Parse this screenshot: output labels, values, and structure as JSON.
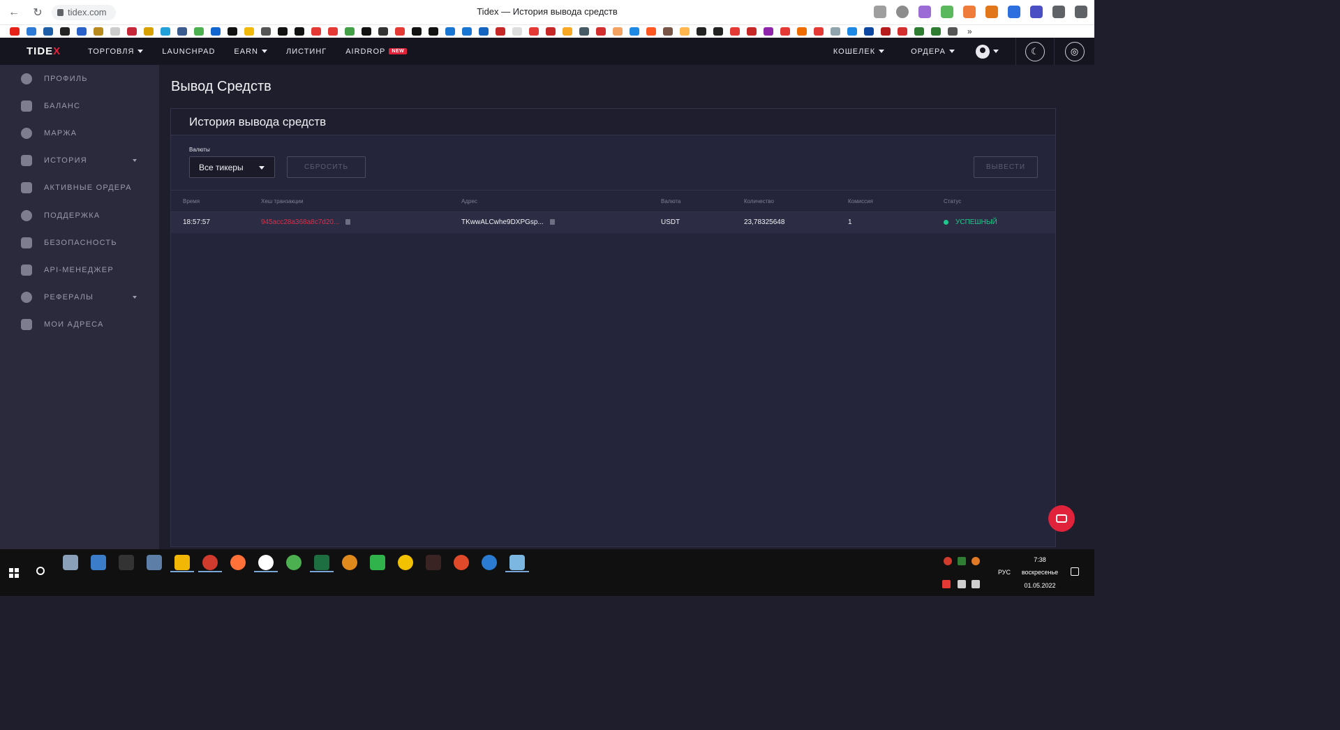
{
  "browser": {
    "url": "tidex.com",
    "window_title": "Tidex — История вывода средств"
  },
  "topnav": {
    "logo_main": "TIDE",
    "logo_x": "X",
    "items": [
      {
        "label": "ТОРГОВЛЯ",
        "has_caret": true
      },
      {
        "label": "LAUNCHPAD",
        "has_caret": false
      },
      {
        "label": "EARN",
        "has_caret": true
      },
      {
        "label": "ЛИСТИНГ",
        "has_caret": false
      },
      {
        "label": "AIRDROP",
        "has_caret": false,
        "badge": "NEW"
      }
    ],
    "right": {
      "wallet": "КОШЕЛЕК",
      "orders": "ОРДЕРА"
    }
  },
  "sidebar": {
    "items": [
      {
        "label": "ПРОФИЛЬ",
        "icon": "profile-icon"
      },
      {
        "label": "БАЛАНС",
        "icon": "balance-icon"
      },
      {
        "label": "МАРЖА",
        "icon": "margin-icon"
      },
      {
        "label": "ИСТОРИЯ",
        "icon": "history-icon"
      },
      {
        "label": "АКТИВНЫЕ ОРДЕРА",
        "icon": "active-orders-icon"
      },
      {
        "label": "ПОДДЕРЖКА",
        "icon": "support-icon"
      },
      {
        "label": "БЕЗОПАСНОСТЬ",
        "icon": "security-icon"
      },
      {
        "label": "API-МЕНЕДЖЕР",
        "icon": "api-icon"
      },
      {
        "label": "РЕФЕРАЛЫ",
        "icon": "referrals-icon"
      },
      {
        "label": "МОИ АДРЕСА",
        "icon": "addresses-icon"
      }
    ]
  },
  "main": {
    "page_title": "Вывод Средств",
    "card_title": "История вывода средств",
    "filter_label": "Валюты",
    "select_value": "Все тикеры",
    "reset_label": "СБРОСИТЬ",
    "withdraw_label": "ВЫВЕСТИ",
    "columns": [
      "Время",
      "Хеш транзакции",
      "Адрес",
      "Валюта",
      "Количество",
      "Комиссия",
      "Статус"
    ],
    "rows": [
      {
        "time": "18:57:57",
        "hash": "945acc28a368a8c7d20...",
        "address": "TKwwALCwhe9DXPGsp...",
        "currency": "USDT",
        "amount": "23,78325648",
        "fee": "1",
        "status": "УСПЕШНЫЙ"
      }
    ]
  },
  "taskbar": {
    "lang": "РУС",
    "time": "7:38",
    "day": "воскресенье",
    "date": "01.05.2022"
  },
  "colors": {
    "accent": "#e0233b",
    "success": "#1ec98c",
    "sidebar_bg": "#2b2a3c",
    "main_bg": "#1e1e2c"
  }
}
